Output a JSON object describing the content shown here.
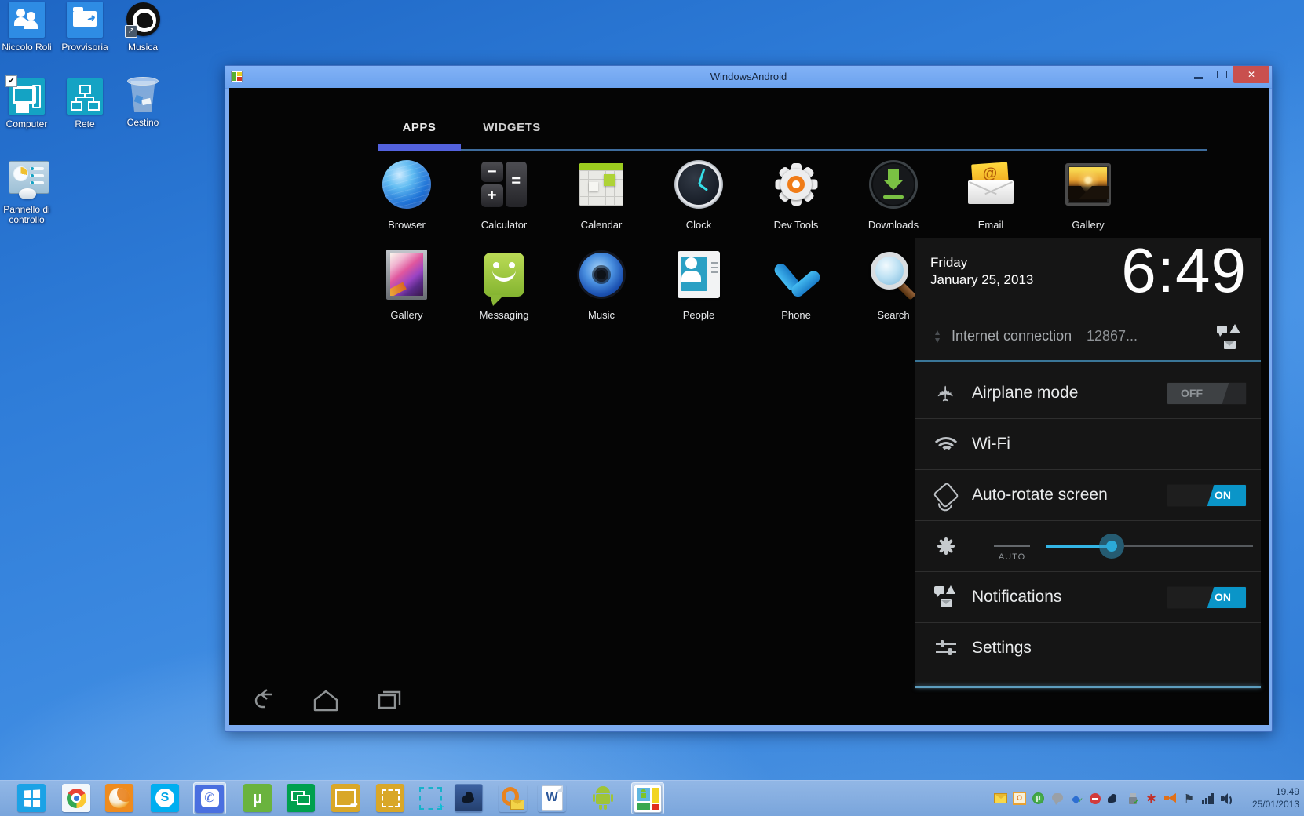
{
  "desktop": {
    "icons": [
      {
        "label": "Niccolo Roli"
      },
      {
        "label": "Provvisoria"
      },
      {
        "label": "Musica"
      },
      {
        "label": "Computer"
      },
      {
        "label": "Rete"
      },
      {
        "label": "Cestino"
      },
      {
        "label": "Pannello di",
        "label2": "controllo"
      }
    ]
  },
  "window": {
    "title": "WindowsAndroid",
    "close_glyph": "✕"
  },
  "android": {
    "tabs": {
      "apps": "APPS",
      "widgets": "WIDGETS"
    },
    "apps_row1": [
      "Browser",
      "Calculator",
      "Calendar",
      "Clock",
      "Dev Tools",
      "Downloads",
      "Email",
      "Gallery"
    ],
    "apps_row2": [
      "Gallery",
      "Messaging",
      "Music",
      "People",
      "Phone",
      "Search"
    ],
    "panel": {
      "day": "Friday",
      "date": "January 25, 2013",
      "time": "6:49",
      "notif_title": "Internet connection",
      "notif_value": "12867...",
      "airplane": {
        "label": "Airplane mode",
        "state": "OFF"
      },
      "wifi": {
        "label": "Wi-Fi"
      },
      "rotate": {
        "label": "Auto-rotate screen",
        "state": "ON"
      },
      "brightness": {
        "auto": "AUTO"
      },
      "notifications": {
        "label": "Notifications",
        "state": "ON"
      },
      "settings": {
        "label": "Settings"
      }
    }
  },
  "taskbar": {
    "clock_time": "19.49",
    "clock_date": "25/01/2013"
  },
  "glyphs": {
    "minus": "−",
    "plus": "+",
    "equals": "=",
    "at": "@",
    "mu": "µ",
    "o": "O",
    "w": "W",
    "s": "S",
    "check": "✓",
    "checkbox": "✔",
    "shortcut_arrow": "↗",
    "diamond": "◆",
    "white_flag": "⚑",
    "pinwheel": "✱",
    "phone": "✆",
    "airplane": "✈",
    "arrow_small": "➜"
  },
  "colors": {
    "accent_blue": "#33b5e5",
    "toggle_on": "#0a95c8",
    "tab_underline": "#5362de",
    "titlebar": "#6ba2ee",
    "taskbar": "#7ca6db",
    "desktop": "#2e7cd8",
    "close_red": "#c9504e"
  }
}
